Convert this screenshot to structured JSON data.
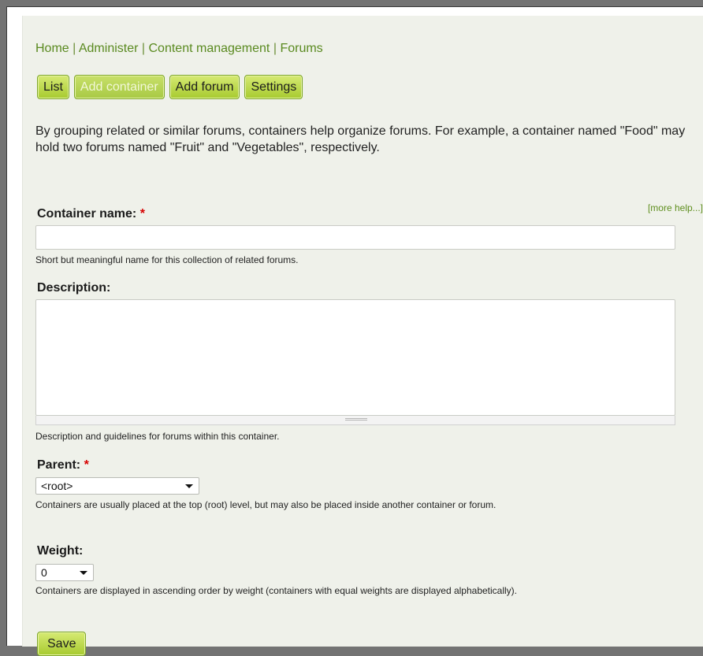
{
  "breadcrumb": {
    "items": [
      "Home",
      "Administer",
      "Content management",
      "Forums"
    ],
    "separator": "|"
  },
  "tabs": [
    {
      "label": "List",
      "active": false
    },
    {
      "label": "Add container",
      "active": true
    },
    {
      "label": "Add forum",
      "active": false
    },
    {
      "label": "Settings",
      "active": false
    }
  ],
  "help_text": "By grouping related or similar forums, containers help organize forums. For example, a container named \"Food\" may hold two forums named \"Fruit\" and \"Vegetables\", respectively.",
  "more_help": "[more help...]",
  "form": {
    "container_name": {
      "label": "Container name:",
      "required_marker": "*",
      "value": "",
      "description": "Short but meaningful name for this collection of related forums."
    },
    "description_field": {
      "label": "Description:",
      "value": "",
      "description": "Description and guidelines for forums within this container."
    },
    "parent": {
      "label": "Parent:",
      "required_marker": "*",
      "selected": "<root>",
      "description": "Containers are usually placed at the top (root) level, but may also be placed inside another container or forum."
    },
    "weight": {
      "label": "Weight:",
      "selected": "0",
      "description": "Containers are displayed in ascending order by weight (containers with equal weights are displayed alphabetically)."
    },
    "save_label": "Save"
  },
  "colors": {
    "link": "#5a8a20",
    "button_top": "#d6ea73",
    "button_bottom": "#a7ca2f",
    "panel_bg": "#eff1ea",
    "required": "#d60000"
  }
}
